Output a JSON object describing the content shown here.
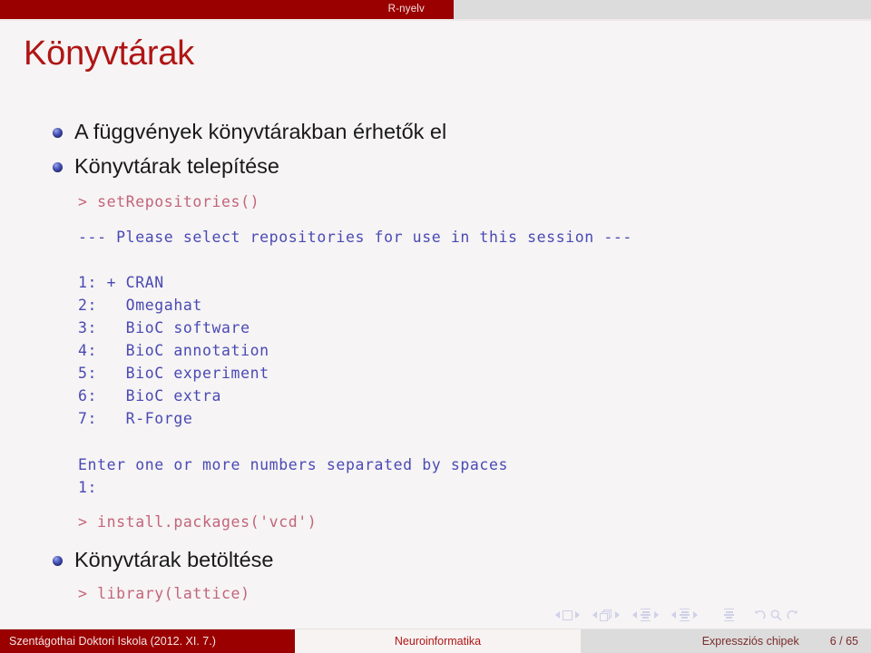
{
  "navbar": {
    "tab_label": "R-nyelv",
    "accent_color": "#9a0000",
    "inactive_color": "#dcdcdc"
  },
  "slide": {
    "title": "Könyvtárak",
    "title_color": "#b01515",
    "background": "#f6f4f4"
  },
  "bullets": [
    {
      "text": "A függvények könyvtárakban érhetők el"
    },
    {
      "text": "Könyvtárak telepítése"
    },
    {
      "text": "Könyvtárak betöltése"
    }
  ],
  "code": {
    "cmd_color": "#c2657a",
    "output_color": "#4a4ab4",
    "set_repositories": "> setRepositories()",
    "please_select": "--- Please select repositories for use in this session ---",
    "repos": [
      "1: + CRAN",
      "2:   Omegahat",
      "3:   BioC software",
      "4:   BioC annotation",
      "5:   BioC experiment",
      "6:   BioC extra",
      "7:   R-Forge"
    ],
    "enter_prompt": "Enter one or more numbers separated by spaces",
    "enter_line": "1:",
    "install_packages": "> install.packages('vcd')",
    "library_lattice": "> library(lattice)"
  },
  "navsymbols": {
    "slide_icon": "slide-icon",
    "frame_icon": "frame-stack-icon",
    "subsection_icon": "subsection-lines-icon",
    "section_icon": "section-lines-icon",
    "presentation_icon": "presentation-lines-icon",
    "back_icon": "back-arrow-icon",
    "search_icon": "search-icon",
    "forward_icon": "forward-arrow-icon"
  },
  "footer": {
    "left": "Szentágothai Doktori Iskola  (2012. XI. 7.)",
    "middle": "Neuroinformatika",
    "right_title": "Expressziós chipek",
    "page": "6 / 65"
  }
}
